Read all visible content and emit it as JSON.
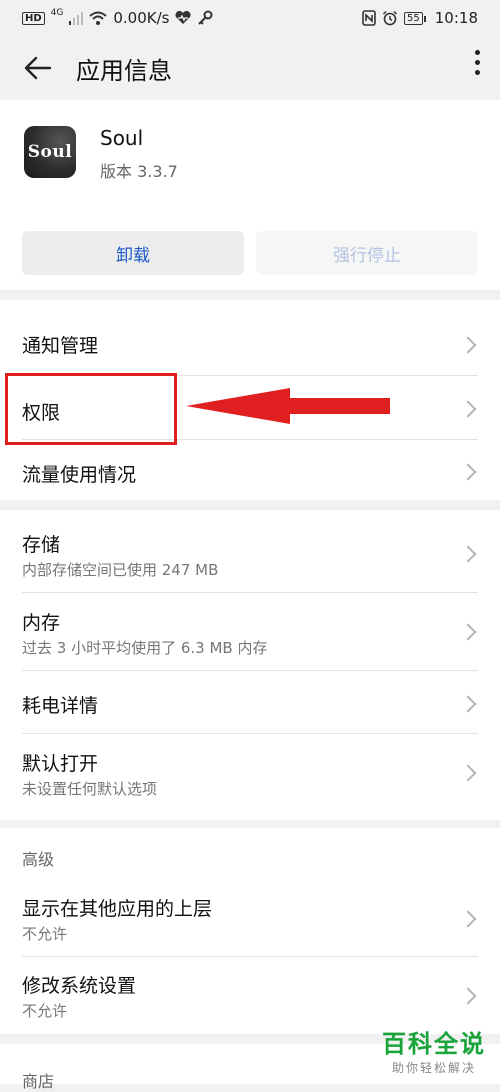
{
  "status_bar": {
    "hd_label": "HD",
    "network_label": "4G",
    "speed": "0.00K/s",
    "battery": "55",
    "time": "10:18",
    "icons": [
      "signal-icon",
      "wifi-icon",
      "health-icon",
      "key-icon",
      "nfc-icon",
      "alarm-icon",
      "battery-icon"
    ]
  },
  "header": {
    "title": "应用信息"
  },
  "app": {
    "icon_text": "Soul",
    "name": "Soul",
    "version": "版本 3.3.7"
  },
  "actions": {
    "uninstall_label": "卸载",
    "force_stop_label": "强行停止"
  },
  "group1": {
    "items": [
      {
        "label": "通知管理"
      },
      {
        "label": "权限"
      },
      {
        "label": "流量使用情况"
      }
    ]
  },
  "group2": {
    "items": [
      {
        "label": "存储",
        "sub": "内部存储空间已使用 247 MB"
      },
      {
        "label": "内存",
        "sub": "过去 3 小时平均使用了 6.3 MB 内存"
      },
      {
        "label": "耗电详情"
      },
      {
        "label": "默认打开",
        "sub": "未设置任何默认选项"
      }
    ]
  },
  "group3": {
    "header": "高级",
    "items": [
      {
        "label": "显示在其他应用的上层",
        "sub": "不允许"
      },
      {
        "label": "修改系统设置",
        "sub": "不允许"
      }
    ]
  },
  "group4": {
    "header": "商店"
  },
  "watermark": {
    "main": "百科全说",
    "sub": "助你轻松解决"
  },
  "colors": {
    "accent": "#1a59c7",
    "annotation": "#e02020",
    "watermark": "#18a33b"
  }
}
